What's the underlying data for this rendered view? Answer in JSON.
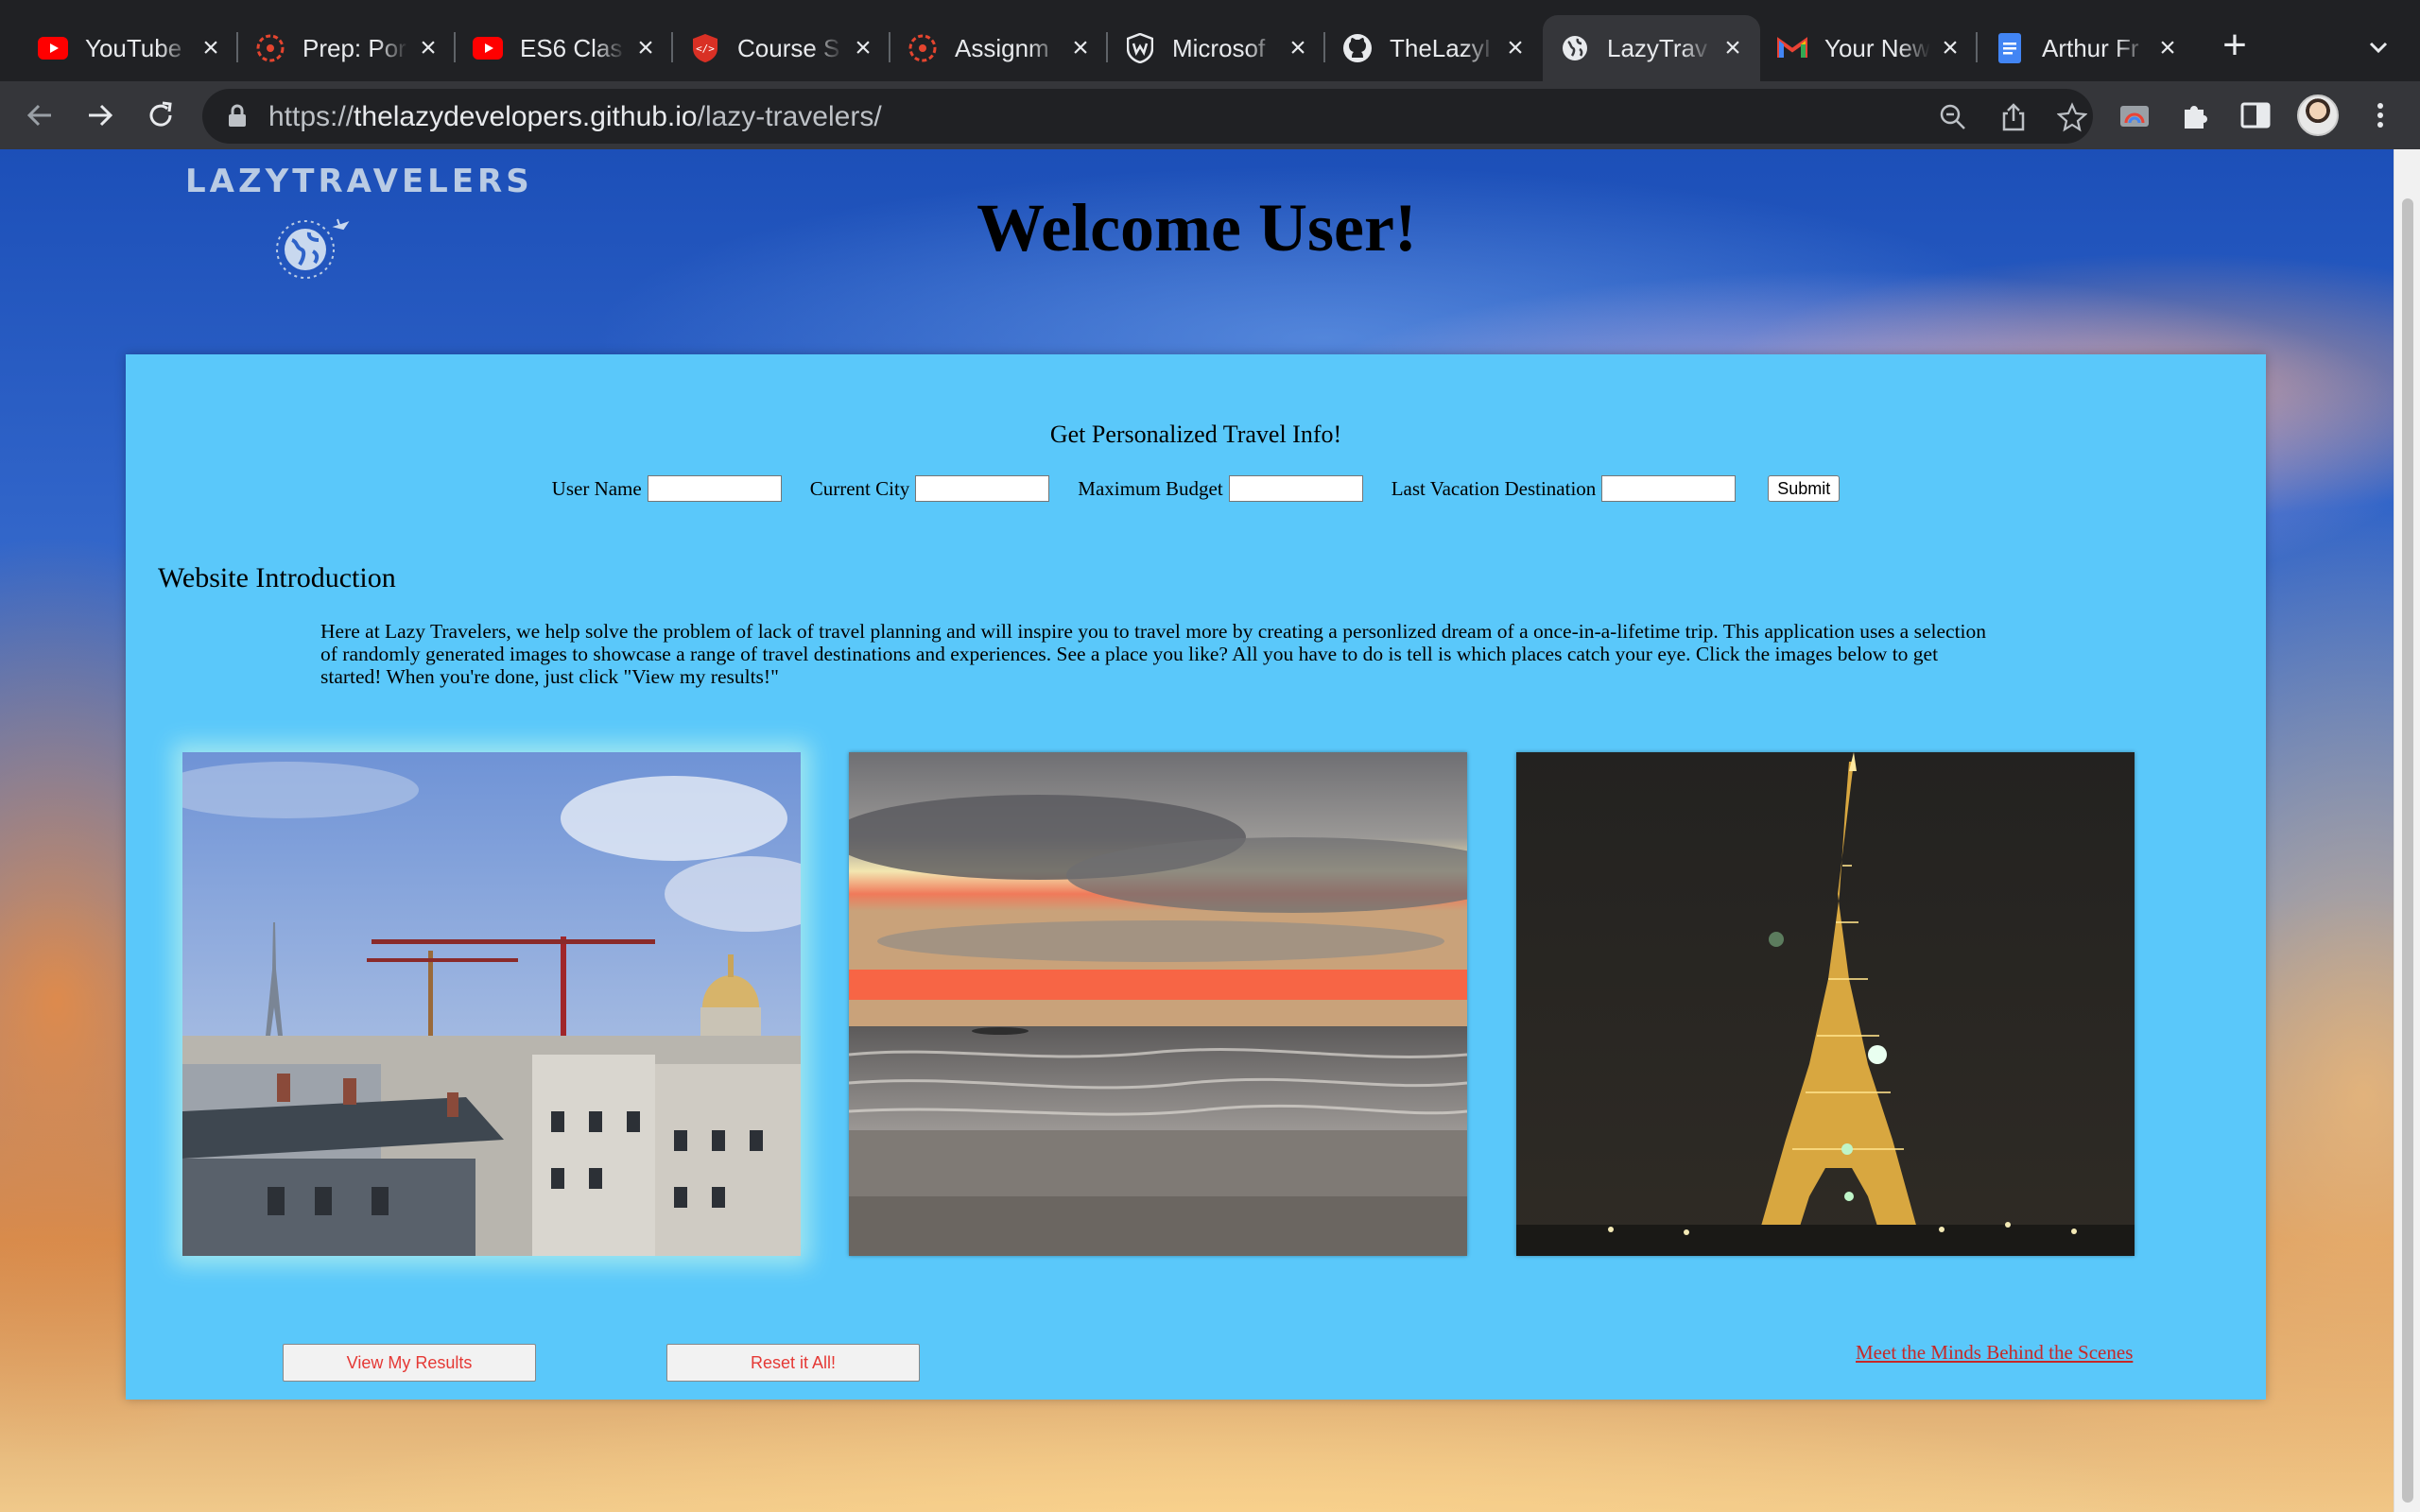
{
  "browser": {
    "tabs": [
      {
        "title": "YouTube",
        "icon": "youtube-icon"
      },
      {
        "title": "Prep: Por",
        "icon": "canvas-icon"
      },
      {
        "title": "ES6 Clas",
        "icon": "youtube-icon"
      },
      {
        "title": "Course S",
        "icon": "shield-code-icon"
      },
      {
        "title": "Assignm",
        "icon": "canvas-icon"
      },
      {
        "title": "Microsof",
        "icon": "microsoft-shield-icon"
      },
      {
        "title": "TheLazyI",
        "icon": "github-icon"
      },
      {
        "title": "LazyTrav",
        "icon": "globe-icon",
        "active": true
      },
      {
        "title": "Your New",
        "icon": "gmail-icon"
      },
      {
        "title": "Arthur Fr",
        "icon": "docs-icon"
      }
    ],
    "url_prefix": "https://",
    "url_host": "thelazydevelopers.github.io",
    "url_path": "/lazy-travelers/"
  },
  "page": {
    "logo_text": "LAZYTRAVELERS",
    "heading": "Welcome User!",
    "form": {
      "title": "Get Personalized Travel Info!",
      "fields": [
        {
          "label": "User Name",
          "value": ""
        },
        {
          "label": "Current City",
          "value": ""
        },
        {
          "label": "Maximum Budget",
          "value": ""
        },
        {
          "label": "Last Vacation Destination",
          "value": ""
        }
      ],
      "submit_label": "Submit"
    },
    "intro": {
      "title": "Website Introduction",
      "text": "Here at Lazy Travelers, we help solve the problem of lack of travel planning and will inspire you to travel more by creating a personlized dream of a once-in-a-lifetime trip. This application uses a selection of randomly generated images to showcase a range of travel destinations and experiences. See a place you like? All you have to do is tell is which places catch your eye. Click the images below to get started! When you're done, just click \"View my results!\""
    },
    "photos": [
      {
        "subject": "paris-rooftops-with-cranes"
      },
      {
        "subject": "beach-sunset"
      },
      {
        "subject": "eiffel-tower-at-night"
      }
    ],
    "view_results_label": "View My Results",
    "reset_label": "Reset it All!",
    "meet_link": "Meet the Minds Behind the Scenes"
  },
  "colors": {
    "card_bg": "#5ac8fa",
    "button_text": "#e53935",
    "link": "#c62828"
  }
}
